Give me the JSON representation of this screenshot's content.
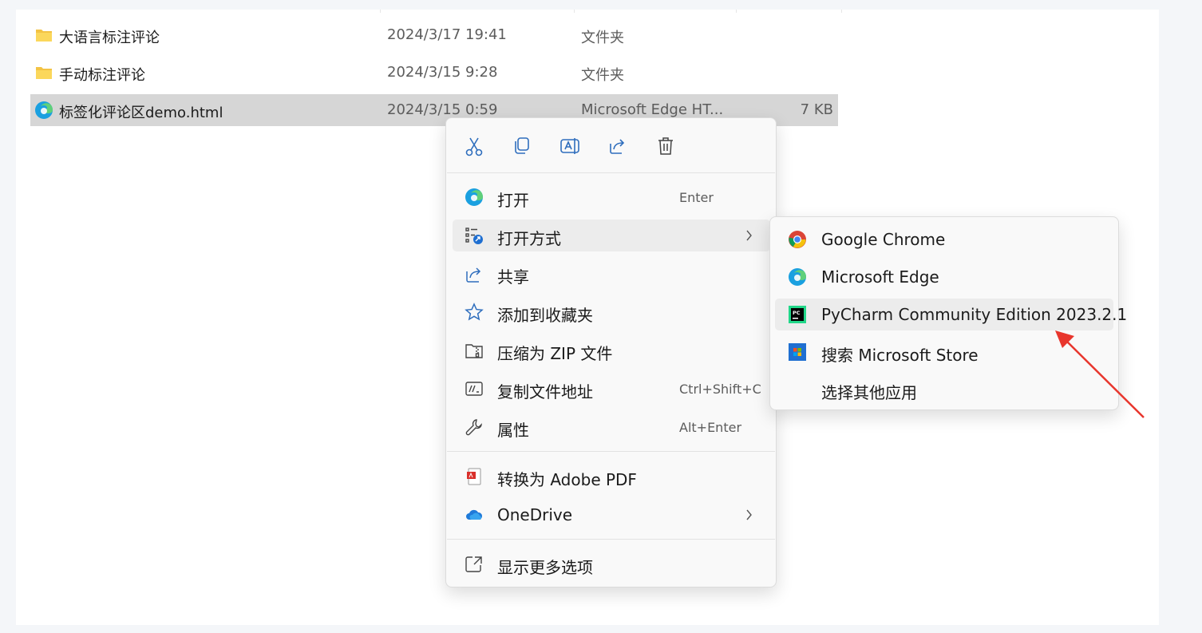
{
  "files": [
    {
      "name": "大语言标注评论",
      "date": "2024/3/17 19:41",
      "type": "文件夹",
      "size": "",
      "icon": "folder-icon"
    },
    {
      "name": "手动标注评论",
      "date": "2024/3/15 9:28",
      "type": "文件夹",
      "size": "",
      "icon": "folder-icon"
    },
    {
      "name": "标签化评论区demo.html",
      "date": "2024/3/15 0:59",
      "type": "Microsoft Edge HT...",
      "size": "7 KB",
      "icon": "edge-icon",
      "selected": true
    }
  ],
  "context_menu": {
    "toolbar": [
      {
        "name": "cut-icon"
      },
      {
        "name": "copy-icon"
      },
      {
        "name": "rename-icon"
      },
      {
        "name": "share-icon"
      },
      {
        "name": "delete-icon"
      }
    ],
    "items": [
      {
        "label": "打开",
        "shortcut": "Enter",
        "icon": "edge-icon"
      },
      {
        "label": "打开方式",
        "shortcut": "",
        "icon": "open-with-icon",
        "submenu": true,
        "highlighted": true
      },
      {
        "label": "共享",
        "shortcut": "",
        "icon": "share-icon"
      },
      {
        "label": "添加到收藏夹",
        "shortcut": "",
        "icon": "star-icon"
      },
      {
        "label": "压缩为 ZIP 文件",
        "shortcut": "",
        "icon": "zip-icon"
      },
      {
        "label": "复制文件地址",
        "shortcut": "Ctrl+Shift+C",
        "icon": "copy-path-icon"
      },
      {
        "label": "属性",
        "shortcut": "Alt+Enter",
        "icon": "wrench-icon"
      },
      {
        "label": "转换为 Adobe PDF",
        "shortcut": "",
        "icon": "adobe-pdf-icon"
      },
      {
        "label": "OneDrive",
        "shortcut": "",
        "icon": "onedrive-icon",
        "submenu": true
      },
      {
        "label": "显示更多选项",
        "shortcut": "",
        "icon": "more-options-icon"
      }
    ]
  },
  "open_with_submenu": {
    "items": [
      {
        "label": "Google Chrome",
        "icon": "chrome-icon"
      },
      {
        "label": "Microsoft Edge",
        "icon": "edge-icon"
      },
      {
        "label": "PyCharm Community Edition 2023.2.1",
        "icon": "pycharm-icon",
        "highlighted": true
      },
      {
        "label": "搜索 Microsoft Store",
        "icon": "microsoft-store-icon"
      },
      {
        "label": "选择其他应用",
        "icon": ""
      }
    ]
  },
  "colors": {
    "selection": "#d6d6d6",
    "menu_bg": "#f9f9f9",
    "hover": "#ececec",
    "accent": "#0067c0",
    "annotation_arrow": "#e8362d"
  }
}
